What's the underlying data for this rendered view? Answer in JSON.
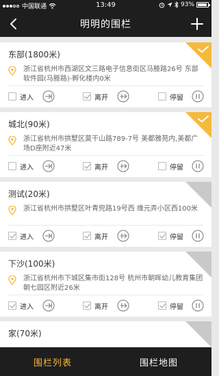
{
  "status_bar": {
    "carrier": "中国联通",
    "time": "13:49",
    "battery": "93%",
    "battery_level": 0.93
  },
  "nav": {
    "title": "明明的围栏",
    "back_icon": "back-chevron-icon",
    "add_icon": "plus-icon"
  },
  "labels": {
    "enter": "进入",
    "leave": "离开",
    "stay": "停留"
  },
  "colors": {
    "accent": "#f5b93c",
    "header_bg": "#1e1e1e",
    "corner_inactive": "#c9c9c9"
  },
  "fences": [
    {
      "name": "东部(1800米)",
      "address": "浙江省杭州市西湖区文三路电子信息街区马塍路26号 东部软件园(马塍路)-孵化楼内0米",
      "active": true,
      "enter": false,
      "leave": true,
      "stay": false
    },
    {
      "name": "城北(90米)",
      "address": "浙江省杭州市拱墅区莫干山路789-7号 美都雅苑内,美都广场D座附近47米",
      "active": true,
      "enter": false,
      "leave": true,
      "stay": false
    },
    {
      "name": "测试(20米)",
      "address": "浙江省杭州市拱墅区叶青兜路19号西 维元弄小区西100米",
      "active": false,
      "enter": true,
      "leave": true,
      "stay": true
    },
    {
      "name": "下沙(100米)",
      "address": "浙江省杭州市下城区集市街128号 杭州市朝晖幼儿教育集团朝七园区附近26米",
      "active": false,
      "enter": true,
      "leave": true,
      "stay": true
    },
    {
      "name": "家(70米)",
      "address": "",
      "active": false,
      "enter": false,
      "leave": false,
      "stay": false
    }
  ],
  "tabs": [
    {
      "label": "围栏列表",
      "active": true
    },
    {
      "label": "围栏地图",
      "active": false
    }
  ]
}
